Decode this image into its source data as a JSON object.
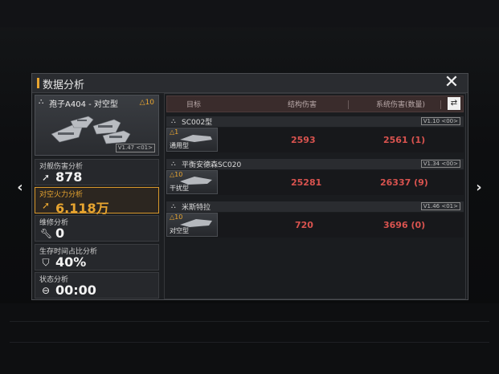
{
  "dialog": {
    "title": "数据分析"
  },
  "unit": {
    "name": "孢子A404 - 对空型",
    "tier": "△10",
    "version": "V1.47 <01>"
  },
  "stats": [
    {
      "label": "对舰伤害分析",
      "value": "878",
      "icon": "attack-arrow-icon",
      "active": false
    },
    {
      "label": "对空火力分析",
      "value": "6.118万",
      "icon": "anti-air-arrow-icon",
      "active": true
    },
    {
      "label": "维修分析",
      "value": "0",
      "icon": "wrench-icon",
      "active": false
    },
    {
      "label": "生存时间占比分析",
      "value": "40%",
      "icon": "shield-icon",
      "active": false
    },
    {
      "label": "状态分析",
      "value": "00:00",
      "icon": "status-icon",
      "active": false
    }
  ],
  "table": {
    "headers": [
      "目标",
      "结构伤害",
      "系统伤害(数量)"
    ],
    "groups": [
      {
        "name": "SC002型",
        "version": "V1.10 <00>",
        "tier": "△1",
        "class": "通用型",
        "structure": "2593",
        "system": "2561 (1)"
      },
      {
        "name": "平衡安德森SC020",
        "version": "V1.34 <00>",
        "tier": "△10",
        "class": "干扰型",
        "structure": "25281",
        "system": "26337 (9)"
      },
      {
        "name": "米斯特拉",
        "version": "V1.46 <01>",
        "tier": "△10",
        "class": "对空型",
        "structure": "720",
        "system": "3696 (0)"
      }
    ]
  },
  "nav": {
    "prev": "‹",
    "next": "›"
  },
  "colors": {
    "accent": "#e8a530",
    "damage": "#d9534f"
  }
}
